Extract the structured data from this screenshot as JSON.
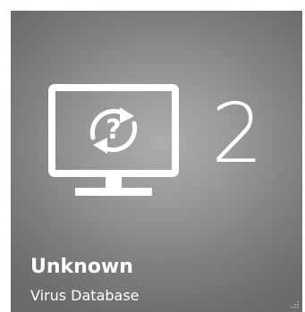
{
  "tile": {
    "count": "2",
    "title": "Unknown",
    "subtitle": "Virus Database",
    "icon": "monitor-refresh-question-icon",
    "colors": {
      "background_center": "#adadad",
      "background_edge": "#6a6a6a",
      "foreground": "#ffffff"
    }
  }
}
